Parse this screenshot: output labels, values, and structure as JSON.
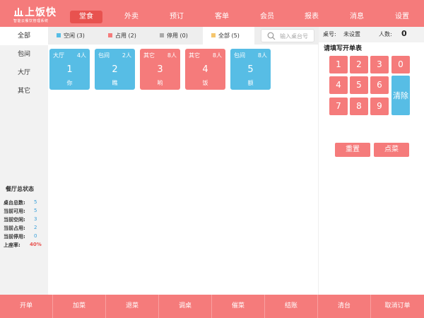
{
  "app": {
    "brand_name": "上饭快",
    "brand_tagline": "智能云餐饮管理系统"
  },
  "nav": {
    "items": [
      {
        "label": "堂食",
        "active": true
      },
      {
        "label": "外卖",
        "active": false
      },
      {
        "label": "预订",
        "active": false
      },
      {
        "label": "客单",
        "active": false
      },
      {
        "label": "会员",
        "active": false
      },
      {
        "label": "报表",
        "active": false
      },
      {
        "label": "消息",
        "active": false
      },
      {
        "label": "设置",
        "active": false
      }
    ]
  },
  "sidebar": {
    "items": [
      {
        "label": "全部",
        "active": true
      },
      {
        "label": "包间",
        "active": false
      },
      {
        "label": "大厅",
        "active": false
      },
      {
        "label": "其它",
        "active": false
      }
    ],
    "stats": {
      "title": "餐厅总状态",
      "rows": [
        {
          "label": "桌台总数:",
          "value": "5"
        },
        {
          "label": "当前可用:",
          "value": "5"
        },
        {
          "label": "当前空闲:",
          "value": "3"
        },
        {
          "label": "当前占用:",
          "value": "2"
        },
        {
          "label": "当前停用:",
          "value": "0"
        },
        {
          "label": "上座率:",
          "value": "40%"
        }
      ]
    }
  },
  "filters": {
    "tabs": [
      {
        "label": "空闲 (3)",
        "color": "#57bde5",
        "active": false
      },
      {
        "label": "占用 (2)",
        "color": "#f57b7b",
        "active": false
      },
      {
        "label": "停用 (0)",
        "color": "#aaaaaa",
        "active": false
      },
      {
        "label": "全部 (5)",
        "color": "#f5c66e",
        "active": true
      }
    ],
    "search_placeholder": "输入桌台号"
  },
  "tables": [
    {
      "zone": "大厅",
      "seats": "4人",
      "number": "1",
      "name": "你",
      "status": "free"
    },
    {
      "zone": "包间",
      "seats": "2人",
      "number": "2",
      "name": "瞧",
      "status": "free"
    },
    {
      "zone": "其它",
      "seats": "8人",
      "number": "3",
      "name": "哟",
      "status": "busy"
    },
    {
      "zone": "其它",
      "seats": "8人",
      "number": "4",
      "name": "饭",
      "status": "busy"
    },
    {
      "zone": "包间",
      "seats": "8人",
      "number": "5",
      "name": "额",
      "status": "free"
    }
  ],
  "order_panel": {
    "table_label": "桌号:",
    "table_value": "未设置",
    "people_label": "人数:",
    "people_value": "0",
    "title": "请填写开单表",
    "keys": [
      "1",
      "2",
      "3",
      "0",
      "4",
      "5",
      "6",
      "7",
      "8",
      "9"
    ],
    "clear_label": "清除",
    "reset_label": "重置",
    "order_label": "点菜"
  },
  "actions": {
    "buttons": [
      "开单",
      "加菜",
      "退菜",
      "调桌",
      "催菜",
      "结账",
      "清台",
      "取消订单"
    ]
  },
  "colors": {
    "accent": "#f57b7b",
    "accent_dark": "#e8524f",
    "free": "#57bde5",
    "busy": "#f57b7b",
    "disabled": "#aaaaaa",
    "all": "#f5c66e"
  }
}
